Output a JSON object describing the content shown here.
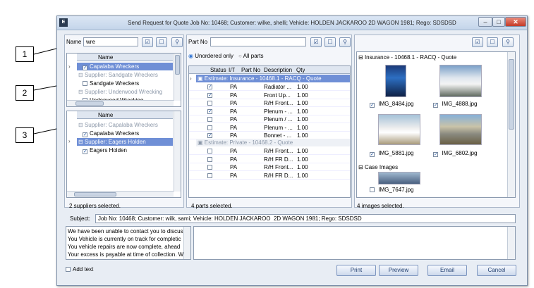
{
  "window": {
    "title": "Send Request for Quote Job No: 10468; Customer: wilke, shelli; Vehicle: HOLDEN JACKAROO  2D WAGON 1981; Rego: SDSDSD",
    "app_icon": "E"
  },
  "callouts": [
    "1",
    "2",
    "3"
  ],
  "suppliers": {
    "name_label": "Name",
    "name_value": "wre",
    "col_name": "Name",
    "top_rows": [
      {
        "text": "Capalaba Wreckers",
        "type": "item",
        "checked": true,
        "selected": true
      },
      {
        "text": "Supplier: Sandgate Wreckers",
        "type": "group"
      },
      {
        "text": "Sandgate Wreckers",
        "type": "item",
        "checked": false
      },
      {
        "text": "Supplier: Underwood Wrecking",
        "type": "group"
      },
      {
        "text": "Underwood Wrecking",
        "type": "item",
        "checked": false
      }
    ],
    "bottom_col": "Name",
    "bottom_rows": [
      {
        "text": "Supplier: Capalaba Wreckers",
        "type": "group"
      },
      {
        "text": "Capalaba Wreckers",
        "type": "item",
        "checked": true
      },
      {
        "text": "Supplier: Eagers Holden",
        "type": "group",
        "selected": true
      },
      {
        "text": "Eagers Holden",
        "type": "item",
        "checked": true
      }
    ],
    "status": "2 suppliers selected."
  },
  "parts": {
    "label": "Part No",
    "value": "",
    "radio_unordered": "Unordered only",
    "radio_all": "All parts",
    "cols": [
      "Status",
      "I/T",
      "Part No",
      "Description",
      "Qty"
    ],
    "group1": "Estimate: Insurance - 10468.1 - RACQ - Quote",
    "rows1": [
      {
        "c": true,
        "it": "PA",
        "d": "Radiator ...",
        "q": "1.00"
      },
      {
        "c": true,
        "it": "PA",
        "d": "Front Up...",
        "q": "1.00"
      },
      {
        "c": false,
        "it": "PA",
        "d": "R/H Front...",
        "q": "1.00"
      },
      {
        "c": true,
        "it": "PA",
        "d": "Plenum - ...",
        "q": "1.00"
      },
      {
        "c": false,
        "it": "PA",
        "d": "Plenum / ...",
        "q": "1.00"
      },
      {
        "c": false,
        "it": "PA",
        "d": "Plenum - ...",
        "q": "1.00"
      },
      {
        "c": true,
        "it": "PA",
        "d": "Bonnet - ...",
        "q": "1.00"
      }
    ],
    "group2": "Estimate: Private - 10468.2 - Quote",
    "rows2": [
      {
        "c": false,
        "it": "PA",
        "d": "R/H Front...",
        "q": "1.00"
      },
      {
        "c": false,
        "it": "PA",
        "d": "R/H FR D...",
        "q": "1.00"
      },
      {
        "c": false,
        "it": "PA",
        "d": "R/H Front...",
        "q": "1.00"
      },
      {
        "c": false,
        "it": "PA",
        "d": "R/H FR D...",
        "q": "1.00"
      }
    ],
    "status": "4 parts selected."
  },
  "images": {
    "group1": "Insurance - 10468.1 - RACQ - Quote",
    "items": [
      {
        "name": "IMG_8484.jpg",
        "checked": true
      },
      {
        "name": "IMG_4888.jpg",
        "checked": true
      },
      {
        "name": "IMG_5881.jpg",
        "checked": true
      },
      {
        "name": "IMG_6802.jpg",
        "checked": true
      }
    ],
    "group2": "Case Images",
    "item5": {
      "name": "IMG_7647.jpg",
      "checked": false
    },
    "status": "4 images selected."
  },
  "subject": {
    "label": "Subject:",
    "value": "Job No: 10468; Customer: wilk, sami; Vehicle: HOLDEN JACKAROO  2D WAGON 1981; Rego: SDSDSD"
  },
  "messages": [
    "We have been unable to contact you to discus",
    "You Vehicle is currently on track for completic",
    "You vehicle repairs are now complete, ahead",
    "Your excess is payable at time of collection. W"
  ],
  "add_text": "Add text",
  "buttons": {
    "print": "Print",
    "preview": "Preview",
    "email": "Email",
    "cancel": "Cancel"
  }
}
